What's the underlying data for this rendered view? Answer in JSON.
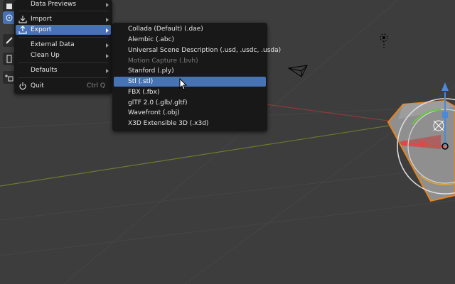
{
  "file_menu": {
    "items": [
      {
        "label": "Data Previews",
        "has_submenu": true
      },
      {
        "label": "Import",
        "has_submenu": true
      },
      {
        "label": "Export",
        "has_submenu": true,
        "highlighted": true
      },
      {
        "label": "External Data",
        "has_submenu": true
      },
      {
        "label": "Clean Up",
        "has_submenu": true
      },
      {
        "label": "Defaults",
        "has_submenu": true
      },
      {
        "label": "Quit",
        "shortcut": "Ctrl Q"
      }
    ]
  },
  "export_menu": {
    "items": [
      {
        "label": "Collada (Default) (.dae)"
      },
      {
        "label": "Alembic (.abc)"
      },
      {
        "label": "Universal Scene Description (.usd, .usdc, .usda)"
      },
      {
        "label": "Motion Capture (.bvh)",
        "disabled": true
      },
      {
        "label": "Stanford (.ply)"
      },
      {
        "label": "Stl (.stl)",
        "highlighted": true
      },
      {
        "label": "FBX (.fbx)"
      },
      {
        "label": "glTF 2.0 (.glb/.gltf)"
      },
      {
        "label": "Wavefront (.obj)"
      },
      {
        "label": "X3D Extensible 3D (.x3d)"
      }
    ]
  },
  "colors": {
    "viewport_bg": "#3d3d3d",
    "menu_bg": "#181818",
    "highlight": "#4772b3",
    "grid_line": "#454545",
    "x_axis": "#8b3a3a",
    "y_axis": "#6b7a2e",
    "object_outline": "#e8841b",
    "object_fill": "#8f8f8f"
  },
  "icons": {
    "import": "import-icon",
    "export": "export-icon",
    "quit": "power-icon",
    "cursor": "mouse-pointer-icon",
    "camera": "camera-icon",
    "light": "light-icon"
  }
}
